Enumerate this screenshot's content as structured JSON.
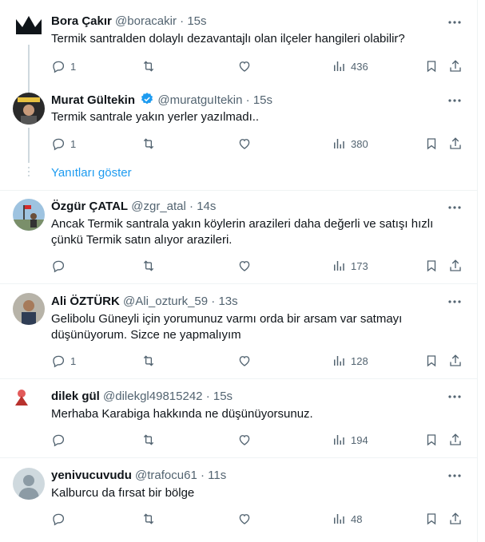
{
  "tweets": [
    {
      "name": "Bora Çakır",
      "handle": "@boracakir",
      "time": "15s",
      "text": "Termik santralden dolaylı dezavantajlı olan ilçeler hangileri olabilir?",
      "replies": "1",
      "views": "436"
    },
    {
      "name": "Murat Gültekin",
      "handle": "@muratguItekin",
      "time": "15s",
      "text": "Termik santrale yakın yerler yazılmadı..",
      "replies": "1",
      "views": "380",
      "verified": true
    },
    {
      "name": "Özgür ÇATAL",
      "handle": "@zgr_atal",
      "time": "14s",
      "text_lines": [
        "Ancak Termik santrala yakın köylerin arazileri daha değerli ve satışı hızlı",
        "çünkü Termik satın alıyor arazileri."
      ],
      "replies": "",
      "views": "173"
    },
    {
      "name": "Ali ÖZTÜRK",
      "handle": "@Ali_ozturk_59",
      "time": "13s",
      "text_lines": [
        "Gelibolu Güneyli için yorumunuz varmı orda bir arsam var satmayı",
        "düşünüyorum. Sizce ne yapmalıyım"
      ],
      "replies": "1",
      "views": "128"
    },
    {
      "name": "dilek gül",
      "handle": "@dilekgl49815242",
      "time": "15s",
      "text": "Merhaba Karabiga hakkında ne düşünüyorsunuz.",
      "replies": "",
      "views": "194"
    },
    {
      "name": "yenivucuvudu",
      "handle": "@trafocu61",
      "time": "11s",
      "text": "Kalburcu da fırsat bir bölge",
      "replies": "",
      "views": "48"
    }
  ],
  "show_replies": "Yanıtları göster",
  "separator": "·",
  "colors": {
    "accent": "#1d9bf0",
    "secondary": "#536471",
    "text": "#0f1419",
    "border": "#eff3f4"
  }
}
